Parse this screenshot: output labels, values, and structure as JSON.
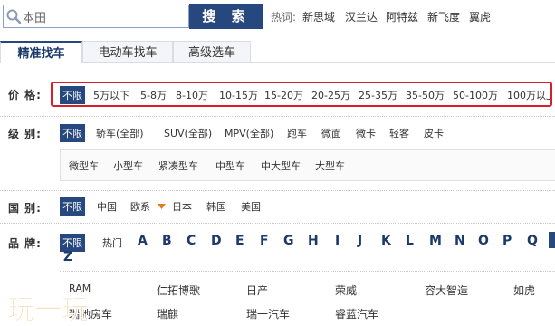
{
  "search": {
    "value": "本田",
    "button_label": "搜 索"
  },
  "hot": {
    "label": "热词:",
    "links": [
      "新思域",
      "汉兰达",
      "阿特兹",
      "新飞度",
      "翼虎"
    ]
  },
  "tabs": [
    "精准找车",
    "电动车找车",
    "高级选车"
  ],
  "price": {
    "label": "价 格:",
    "options": [
      "不限",
      "5万以下",
      "5-8万",
      "8-10万",
      "10-15万",
      "15-20万",
      "20-25万",
      "25-35万",
      "35-50万",
      "50-100万",
      "100万以上"
    ]
  },
  "level": {
    "label": "级 别:",
    "options": [
      "不限",
      "轿车(全部)",
      "SUV(全部)",
      "MPV(全部)",
      "跑车",
      "微面",
      "微卡",
      "轻客",
      "皮卡"
    ],
    "sub_options": [
      "微型车",
      "小型车",
      "紧凑型车",
      "中型车",
      "中大型车",
      "大型车"
    ]
  },
  "country": {
    "label": "国 别:",
    "options": [
      "不限",
      "中国",
      "欧系",
      "日本",
      "韩国",
      "美国"
    ]
  },
  "brand": {
    "label": "品 牌:",
    "options": [
      "不限",
      "热门"
    ],
    "letters": [
      "A",
      "B",
      "C",
      "D",
      "E",
      "F",
      "G",
      "H",
      "I",
      "J",
      "K",
      "L",
      "M",
      "N",
      "O",
      "P",
      "Q",
      "Z"
    ],
    "list_row1": [
      "RAM",
      "仁拓博歌",
      "日产",
      "荣威",
      "容大智造",
      "如虎"
    ],
    "list_row2": [
      "瑞驰房车",
      "瑞麒",
      "瑞一汽车",
      "睿蓝汽车"
    ]
  },
  "watermark": {
    "text": "玩一玩"
  },
  "colors": {
    "accent": "#27487f",
    "highlight": "#d81e2b"
  }
}
